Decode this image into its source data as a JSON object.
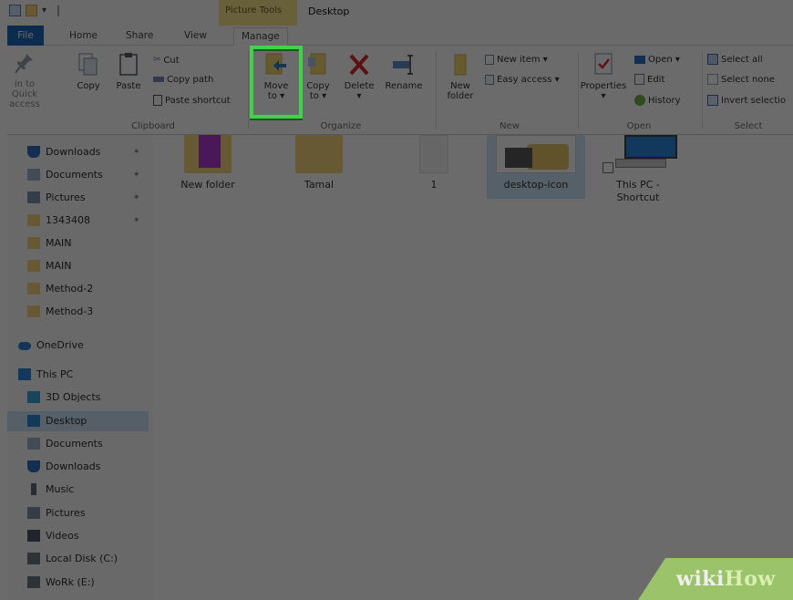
{
  "window": {
    "context_tab_group": "Picture Tools",
    "title": "Desktop"
  },
  "tabs": [
    {
      "label": "File"
    },
    {
      "label": "Home"
    },
    {
      "label": "Share"
    },
    {
      "label": "View"
    },
    {
      "label": "Manage"
    }
  ],
  "ribbon": {
    "clipboard": {
      "pin_label_1": "in to Quick",
      "pin_label_2": "access",
      "copy": "Copy",
      "paste": "Paste",
      "cut": "Cut",
      "copy_path": "Copy path",
      "paste_shortcut": "Paste shortcut",
      "group_label": "Clipboard"
    },
    "organize": {
      "move_to_1": "Move",
      "move_to_2": "to ▾",
      "copy_to_1": "Copy",
      "copy_to_2": "to ▾",
      "delete_1": "Delete",
      "delete_2": "▾",
      "rename": "Rename",
      "group_label": "Organize"
    },
    "new": {
      "new_folder_1": "New",
      "new_folder_2": "folder",
      "new_item": "New item ▾",
      "easy_access": "Easy access ▾",
      "group_label": "New"
    },
    "open": {
      "properties_1": "Properties",
      "properties_2": "▾",
      "open": "Open ▾",
      "edit": "Edit",
      "history": "History",
      "group_label": "Open"
    },
    "select": {
      "select_all": "Select all",
      "select_none": "Select none",
      "invert_selection": "Invert selectio",
      "group_label": "Select"
    }
  },
  "nav": {
    "items": [
      {
        "label": "Downloads",
        "icon": "download-arrow-icon",
        "pinned": true
      },
      {
        "label": "Documents",
        "icon": "document-icon",
        "pinned": true
      },
      {
        "label": "Pictures",
        "icon": "pictures-icon",
        "pinned": true
      },
      {
        "label": "1343408",
        "icon": "folder-icon",
        "pinned": true
      },
      {
        "label": "MAIN",
        "icon": "folder-icon",
        "pinned": false
      },
      {
        "label": "MAIN",
        "icon": "folder-icon",
        "pinned": false
      },
      {
        "label": "Method-2",
        "icon": "folder-icon",
        "pinned": false
      },
      {
        "label": "Method-3",
        "icon": "folder-icon",
        "pinned": false
      },
      {
        "label": "OneDrive",
        "icon": "onedrive-cloud-icon",
        "pinned": false
      },
      {
        "label": "This PC",
        "icon": "computer-icon",
        "pinned": false
      },
      {
        "label": "3D Objects",
        "icon": "3d-objects-icon",
        "pinned": false
      },
      {
        "label": "Desktop",
        "icon": "desktop-icon",
        "pinned": false,
        "selected": true
      },
      {
        "label": "Documents",
        "icon": "document-icon",
        "pinned": false
      },
      {
        "label": "Downloads",
        "icon": "download-arrow-icon",
        "pinned": false
      },
      {
        "label": "Music",
        "icon": "music-note-icon",
        "pinned": false
      },
      {
        "label": "Pictures",
        "icon": "pictures-icon",
        "pinned": false
      },
      {
        "label": "Videos",
        "icon": "video-icon",
        "pinned": false
      },
      {
        "label": "Local Disk (C:)",
        "icon": "hard-drive-icon",
        "pinned": false
      },
      {
        "label": "WoRk (E:)",
        "icon": "hard-drive-icon",
        "pinned": false
      }
    ]
  },
  "files": [
    {
      "name": "New folder",
      "icon": "folder-with-image-icon"
    },
    {
      "name": "Tamal",
      "icon": "folder-icon"
    },
    {
      "name": "1",
      "icon": "blank-file-icon"
    },
    {
      "name": "desktop-icon",
      "icon": "image-thumbnail-icon",
      "selected": true
    },
    {
      "name_1": "This PC -",
      "name_2": "Shortcut",
      "icon": "computer-shortcut-icon"
    }
  ],
  "watermark": {
    "wiki": "wiki",
    "how": "How"
  },
  "colors": {
    "highlight": "#3fd24a",
    "file_tab": "#1c6ab9",
    "context_group": "#f6e58c",
    "selection": "#cce4f7"
  }
}
